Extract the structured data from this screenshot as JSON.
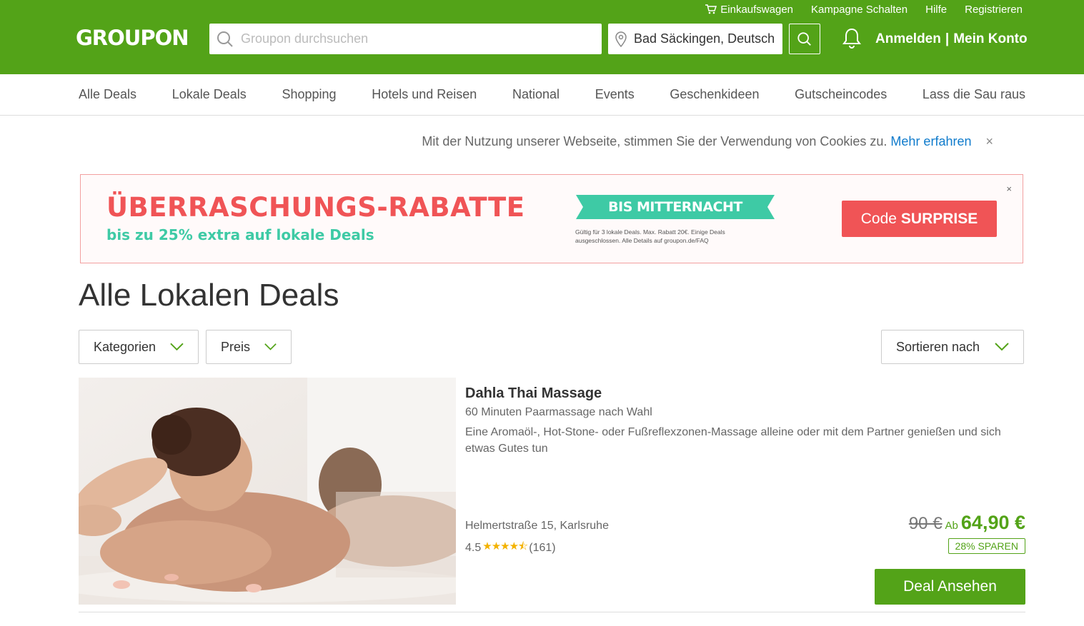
{
  "header": {
    "logo": "GROUPON",
    "links": [
      "Einkaufswagen",
      "Kampagne Schalten",
      "Hilfe",
      "Registrieren"
    ],
    "search_placeholder": "Groupon durchsuchen",
    "location": "Bad Säckingen, Deutsch",
    "login": "Anmelden",
    "separator": "|",
    "account": "Mein Konto",
    "brand_color": "#53a318"
  },
  "nav": {
    "items": [
      "Alle Deals",
      "Lokale Deals",
      "Shopping",
      "Hotels und Reisen",
      "National",
      "Events",
      "Geschenkideen",
      "Gutscheincodes",
      "Lass die Sau raus"
    ]
  },
  "cookie": {
    "text": "Mit der Nutzung unserer Webseite, stimmen Sie der Verwendung von Cookies zu.",
    "link": "Mehr erfahren",
    "close": "×"
  },
  "banner": {
    "headline": "ÜBERRASCHUNGS-RABATTE",
    "subline": "bis zu 25% extra auf lokale Deals",
    "ribbon": "BIS MITTERNACHT",
    "fine_print": "Gültig für 3 lokale Deals. Max. Rabatt 20€. Einige Deals ausgeschlossen. Alle Details auf groupon.de/FAQ",
    "code_prefix": "Code",
    "code": "SURPRISE",
    "close": "×"
  },
  "page_title": "Alle Lokalen Deals",
  "filters": {
    "categories": "Kategorien",
    "price": "Preis",
    "sort": "Sortieren nach"
  },
  "deal": {
    "title": "Dahla Thai Massage",
    "subtitle": "60 Minuten Paarmassage nach Wahl",
    "description": "Eine Aromaöl-, Hot-Stone- oder Fußreflexzonen-Massage alleine oder mit dem Partner genießen und sich etwas Gutes tun",
    "location": "Helmertstraße 15, Karlsruhe",
    "rating": "4.5",
    "stars": "★★★★⯪",
    "reviews": "(161)",
    "old_price": "90 €",
    "from": "Ab",
    "price": "64,90 €",
    "save": "28% SPAREN",
    "cta": "Deal Ansehen"
  }
}
